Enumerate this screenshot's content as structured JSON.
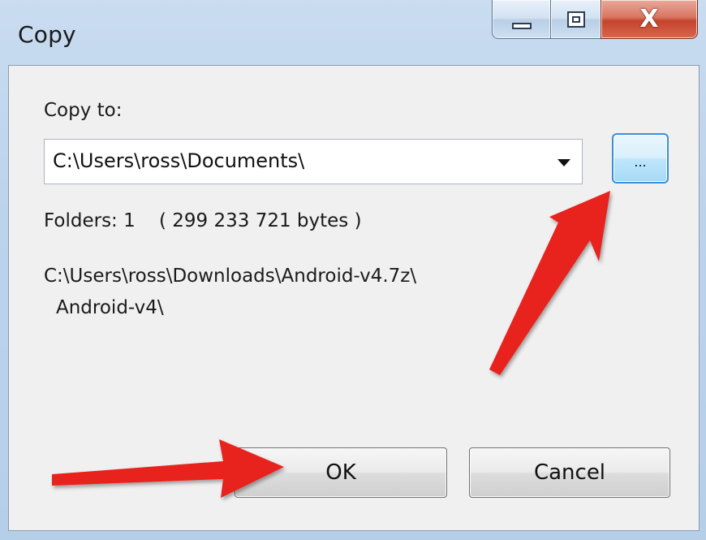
{
  "window": {
    "title": "Copy",
    "minimize_icon": "minimize-icon",
    "maximize_icon": "maximize-icon",
    "close_icon": "close-icon",
    "close_glyph": "X"
  },
  "dialog": {
    "copy_to_label": "Copy to:",
    "destination_path": "C:\\Users\\ross\\Documents\\",
    "dropdown_icon": "chevron-down-icon",
    "browse_label": "...",
    "folders_info": "Folders: 1    ( 299 233 721 bytes )",
    "source_path_line1": "C:\\Users\\ross\\Downloads\\Android-v4.7z\\",
    "source_path_line2": "Android-v4\\",
    "ok_label": "OK",
    "cancel_label": "Cancel"
  },
  "annotations": {
    "arrow_color": "#e8231c",
    "arrow_icon": "red-arrow-icon"
  },
  "colors": {
    "title_bar": "#bcd3ec",
    "client_bg": "#f0f0f0",
    "close_button": "#c4442c",
    "browse_border": "#3c8fd6"
  }
}
